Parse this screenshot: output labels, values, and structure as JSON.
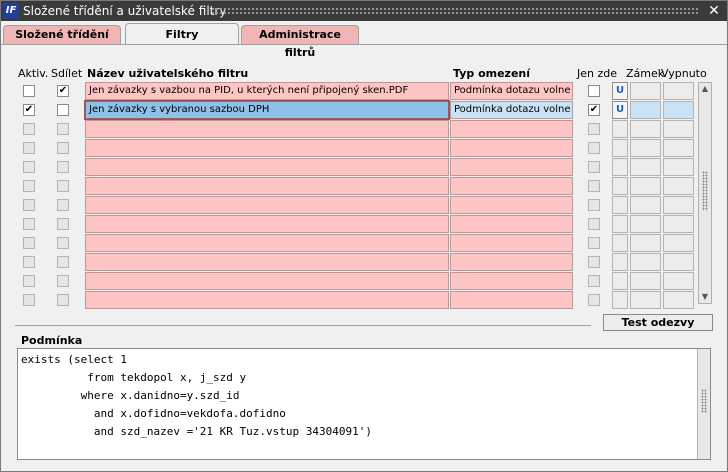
{
  "window": {
    "title": "Složené třídění a uživatelské filtry",
    "icon": "app-icon",
    "app_icon_text": "IF"
  },
  "tabs": [
    {
      "label": "Složené třídění",
      "active": false
    },
    {
      "label": "Filtry",
      "active": true
    },
    {
      "label": "Administrace filtrů",
      "active": false
    }
  ],
  "table": {
    "headers": {
      "aktiv": "Aktiv.",
      "sdilet": "Sdílet",
      "nazev": "Název uživatelského filtru",
      "typ": "Typ omezení",
      "jen_zde": "Jen zde",
      "zamek": "Zámek",
      "vypnuto": "Vypnuto"
    },
    "rows": [
      {
        "aktiv": false,
        "sdilet": true,
        "nazev": "Jen závazky s vazbou na PID, u kterých není připojený sken.PDF",
        "typ": "Podmínka dotazu volne",
        "jen_zde": false,
        "zamek": "U"
      },
      {
        "aktiv": true,
        "sdilet": false,
        "nazev": "Jen závazky s vybranou sazbou DPH",
        "typ": "Podmínka dotazu volne",
        "jen_zde": true,
        "zamek": "U"
      },
      {
        "aktiv": false,
        "sdilet": false,
        "nazev": "",
        "typ": "",
        "jen_zde": false,
        "zamek": ""
      },
      {
        "aktiv": false,
        "sdilet": false,
        "nazev": "",
        "typ": "",
        "jen_zde": false,
        "zamek": ""
      },
      {
        "aktiv": false,
        "sdilet": false,
        "nazev": "",
        "typ": "",
        "jen_zde": false,
        "zamek": ""
      },
      {
        "aktiv": false,
        "sdilet": false,
        "nazev": "",
        "typ": "",
        "jen_zde": false,
        "zamek": ""
      },
      {
        "aktiv": false,
        "sdilet": false,
        "nazev": "",
        "typ": "",
        "jen_zde": false,
        "zamek": ""
      },
      {
        "aktiv": false,
        "sdilet": false,
        "nazev": "",
        "typ": "",
        "jen_zde": false,
        "zamek": ""
      },
      {
        "aktiv": false,
        "sdilet": false,
        "nazev": "",
        "typ": "",
        "jen_zde": false,
        "zamek": ""
      },
      {
        "aktiv": false,
        "sdilet": false,
        "nazev": "",
        "typ": "",
        "jen_zde": false,
        "zamek": ""
      },
      {
        "aktiv": false,
        "sdilet": false,
        "nazev": "",
        "typ": "",
        "jen_zde": false,
        "zamek": ""
      },
      {
        "aktiv": false,
        "sdilet": false,
        "nazev": "",
        "typ": "",
        "jen_zde": false,
        "zamek": ""
      }
    ],
    "selected_row": 1
  },
  "buttons": {
    "test_odezvy": "Test odezvy"
  },
  "condition": {
    "label": "Podmínka",
    "text": "exists (select 1\n          from tekdopol x, j_szd y\n         where x.danidno=y.szd_id\n           and x.dofidno=vekdofa.dofidno\n           and szd_nazev ='21 KR Tuz.vstup 34304091')"
  },
  "colors": {
    "row_bg": "#ffc4c4",
    "selected_bg": "#8ec2ea",
    "tab_inactive": "#f0b6b6"
  },
  "icons": {
    "close": "close-icon",
    "scroll_up": "arrow-up-icon",
    "scroll_down": "arrow-down-icon"
  }
}
